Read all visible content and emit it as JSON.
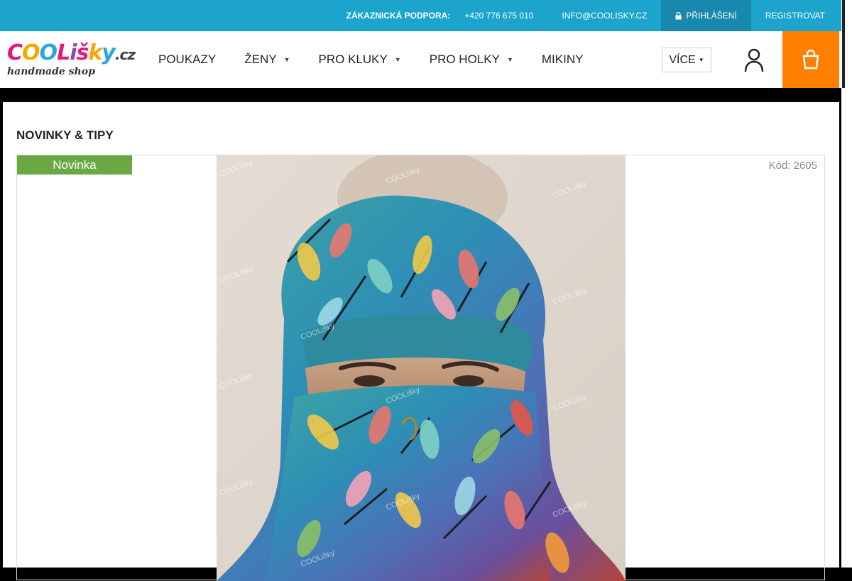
{
  "topbar": {
    "support_label": "ZÁKAZNICKÁ PODPORA:",
    "phone": "+420 776 675 010",
    "email": "INFO@COOLISKY.CZ",
    "login_icon": "lock-icon",
    "login": "PŘIHLÁŠENÍ",
    "register": "REGISTROVAT"
  },
  "logo": {
    "letters": [
      "C",
      "O",
      "O",
      "L",
      "i",
      "š",
      "k",
      "y"
    ],
    "letter_colors": [
      "#e3177d",
      "#f7a700",
      "#2aa7e0",
      "#e3177d",
      "#8e44ad",
      "#e3177d",
      "#f7a700",
      "#2aa7e0"
    ],
    "tld": ".cz",
    "tagline": "handmade shop"
  },
  "nav": {
    "items": [
      {
        "label": "POUKAZY",
        "has_submenu": false
      },
      {
        "label": "ŽENY",
        "has_submenu": true
      },
      {
        "label": "PRO KLUKY",
        "has_submenu": true
      },
      {
        "label": "PRO HOLKY",
        "has_submenu": true
      },
      {
        "label": "MIKINY",
        "has_submenu": false
      }
    ],
    "more": "VÍCE",
    "user_icon": "user-icon",
    "cart_icon": "cart-icon"
  },
  "section": {
    "title": "NOVINKY & TIPY"
  },
  "product": {
    "badge": "Novinka",
    "code": "Kód: 2605",
    "watermark": "COOLišky",
    "image_icon": "spinner-icon"
  },
  "colors": {
    "topbar": "#1ca4cc",
    "login_bg": "#1888ae",
    "cart": "#ff8000",
    "badge": "#6aa843"
  }
}
